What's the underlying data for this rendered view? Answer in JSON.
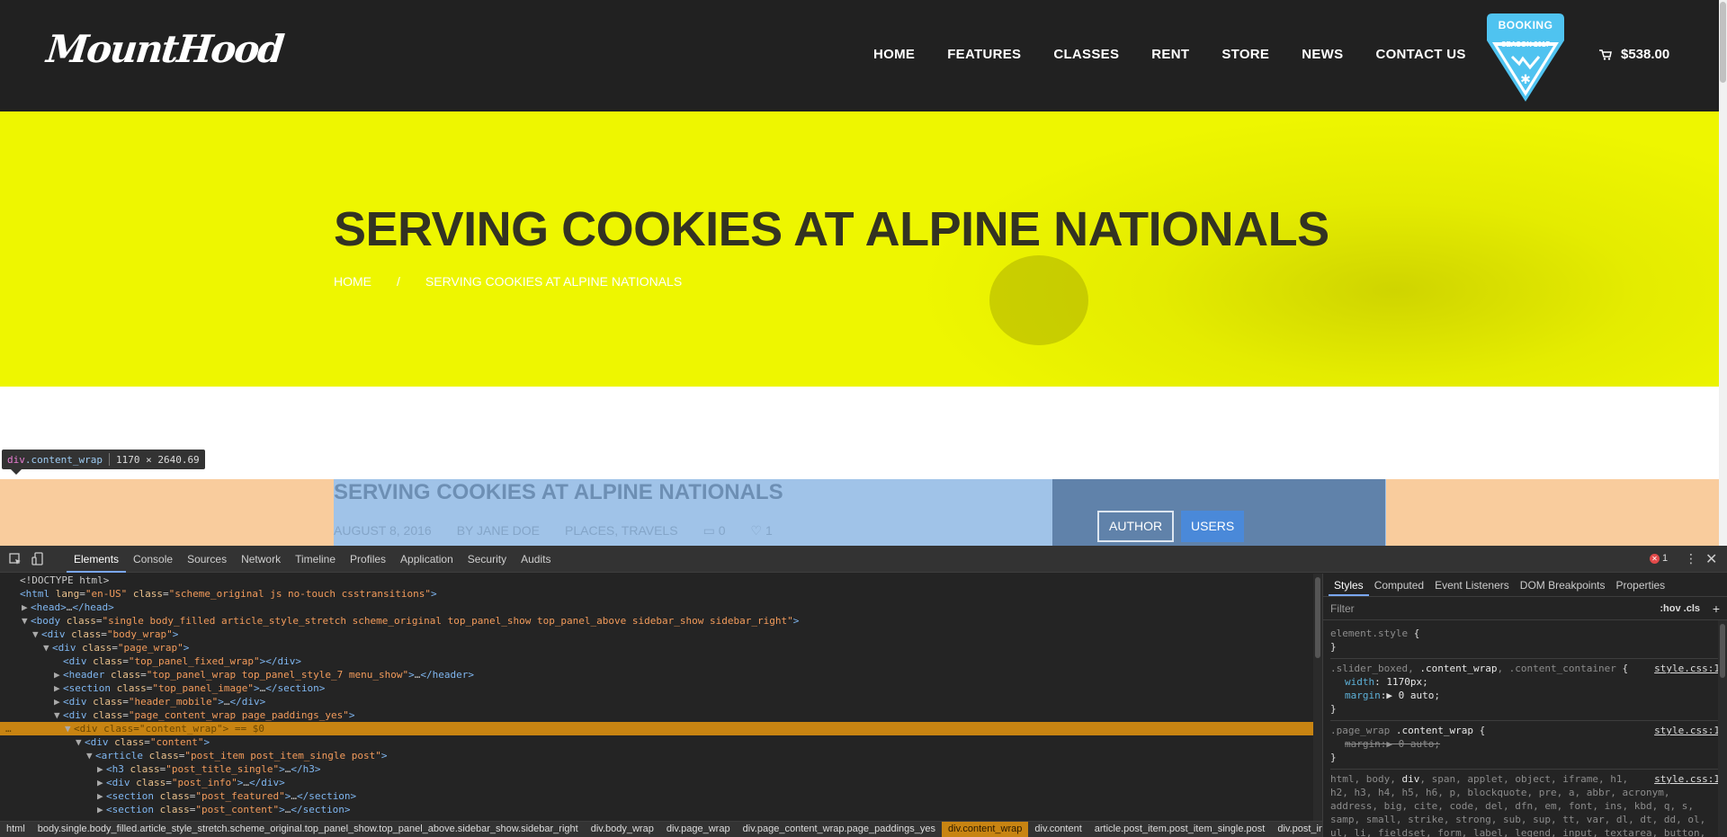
{
  "site": {
    "logo": "MountHood",
    "nav": [
      "HOME",
      "FEATURES",
      "CLASSES",
      "RENT",
      "STORE",
      "NEWS",
      "CONTACT US"
    ],
    "booking": {
      "label": "BOOKING",
      "season": "SEASON 2017"
    },
    "cart_total": "$538.00"
  },
  "hero": {
    "title": "SERVING COOKIES AT ALPINE NATIONALS",
    "breadcrumb_home": "HOME",
    "breadcrumb_sep": "/",
    "breadcrumb_current": "SERVING COOKIES AT ALPINE NATIONALS"
  },
  "inspect": {
    "tag": "div",
    "cls": ".content_wrap",
    "size": "1170 × 2640.69"
  },
  "post": {
    "title": "SERVING COOKIES AT ALPINE NATIONALS",
    "date": "AUGUST 8, 2016",
    "author": "BY JANE DOE",
    "categories": "PLACES, TRAVELS",
    "comments": "0",
    "likes": "1",
    "tab_author": "AUTHOR",
    "tab_users": "USERS"
  },
  "devtools": {
    "tabs": [
      "Elements",
      "Console",
      "Sources",
      "Network",
      "Timeline",
      "Profiles",
      "Application",
      "Security",
      "Audits"
    ],
    "error_count": "1",
    "dom": [
      {
        "indent": 0,
        "tri": "",
        "html": "&lt;!DOCTYPE html&gt;"
      },
      {
        "indent": 0,
        "tri": "",
        "html": "<span class='t-tag'>&lt;html</span> <span class='t-attr'>lang</span>=<span class='t-val'>\"en-US\"</span> <span class='t-attr'>class</span>=<span class='t-val'>\"scheme_original js no-touch csstransitions\"</span><span class='t-tag'>&gt;</span>"
      },
      {
        "indent": 1,
        "tri": "▶",
        "html": "<span class='t-tag'>&lt;head&gt;</span><span class='t-plain'>…</span><span class='t-tag'>&lt;/head&gt;</span>"
      },
      {
        "indent": 1,
        "tri": "▼",
        "html": "<span class='t-tag'>&lt;body</span> <span class='t-attr'>class</span>=<span class='t-val'>\"single body_filled article_style_stretch scheme_original top_panel_show top_panel_above sidebar_show sidebar_right\"</span><span class='t-tag'>&gt;</span>"
      },
      {
        "indent": 2,
        "tri": "▼",
        "html": "<span class='t-tag'>&lt;div</span> <span class='t-attr'>class</span>=<span class='t-val'>\"body_wrap\"</span><span class='t-tag'>&gt;</span>"
      },
      {
        "indent": 3,
        "tri": "▼",
        "html": "<span class='t-tag'>&lt;div</span> <span class='t-attr'>class</span>=<span class='t-val'>\"page_wrap\"</span><span class='t-tag'>&gt;</span>"
      },
      {
        "indent": 4,
        "tri": "",
        "html": "<span class='t-tag'>&lt;div</span> <span class='t-attr'>class</span>=<span class='t-val'>\"top_panel_fixed_wrap\"</span><span class='t-tag'>&gt;&lt;/div&gt;</span>"
      },
      {
        "indent": 4,
        "tri": "▶",
        "html": "<span class='t-tag'>&lt;header</span> <span class='t-attr'>class</span>=<span class='t-val'>\"top_panel_wrap top_panel_style_7 menu_show\"</span><span class='t-tag'>&gt;</span><span class='t-plain'>…</span><span class='t-tag'>&lt;/header&gt;</span>"
      },
      {
        "indent": 4,
        "tri": "▶",
        "html": "<span class='t-tag'>&lt;section</span> <span class='t-attr'>class</span>=<span class='t-val'>\"top_panel_image\"</span><span class='t-tag'>&gt;</span><span class='t-plain'>…</span><span class='t-tag'>&lt;/section&gt;</span>"
      },
      {
        "indent": 4,
        "tri": "▶",
        "html": "<span class='t-tag'>&lt;div</span> <span class='t-attr'>class</span>=<span class='t-val'>\"header_mobile\"</span><span class='t-tag'>&gt;</span><span class='t-plain'>…</span><span class='t-tag'>&lt;/div&gt;</span>"
      },
      {
        "indent": 4,
        "tri": "▼",
        "html": "<span class='t-tag'>&lt;div</span> <span class='t-attr'>class</span>=<span class='t-val'>\"page_content_wrap page_paddings_yes\"</span><span class='t-tag'>&gt;</span>"
      },
      {
        "indent": 5,
        "tri": "▼",
        "selected": true,
        "html": "<span class='t-tag'>&lt;div</span> <span class='t-attr'>class</span>=<span class='t-val'>\"content_wrap\"</span><span class='t-tag'>&gt;</span> <span class='t-plain'>== $0</span>"
      },
      {
        "indent": 6,
        "tri": "▼",
        "html": "<span class='t-tag'>&lt;div</span> <span class='t-attr'>class</span>=<span class='t-val'>\"content\"</span><span class='t-tag'>&gt;</span>"
      },
      {
        "indent": 7,
        "tri": "▼",
        "html": "<span class='t-tag'>&lt;article</span> <span class='t-attr'>class</span>=<span class='t-val'>\"post_item post_item_single post\"</span><span class='t-tag'>&gt;</span>"
      },
      {
        "indent": 8,
        "tri": "▶",
        "html": "<span class='t-tag'>&lt;h3</span> <span class='t-attr'>class</span>=<span class='t-val'>\"post_title_single\"</span><span class='t-tag'>&gt;</span><span class='t-plain'>…</span><span class='t-tag'>&lt;/h3&gt;</span>"
      },
      {
        "indent": 8,
        "tri": "▶",
        "html": "<span class='t-tag'>&lt;div</span> <span class='t-attr'>class</span>=<span class='t-val'>\"post_info\"</span><span class='t-tag'>&gt;</span><span class='t-plain'>…</span><span class='t-tag'>&lt;/div&gt;</span>"
      },
      {
        "indent": 8,
        "tri": "▶",
        "html": "<span class='t-tag'>&lt;section</span> <span class='t-attr'>class</span>=<span class='t-val'>\"post_featured\"</span><span class='t-tag'>&gt;</span><span class='t-plain'>…</span><span class='t-tag'>&lt;/section&gt;</span>"
      },
      {
        "indent": 8,
        "tri": "▶",
        "html": "<span class='t-tag'>&lt;section</span> <span class='t-attr'>class</span>=<span class='t-val'>\"post_content\"</span><span class='t-tag'>&gt;</span><span class='t-plain'>…</span><span class='t-tag'>&lt;/section&gt;</span>"
      }
    ],
    "crumbs": [
      "html",
      "body.single.body_filled.article_style_stretch.scheme_original.top_panel_show.top_panel_above.sidebar_show.sidebar_right",
      "div.body_wrap",
      "div.page_wrap",
      "div.page_content_wrap.page_paddings_yes",
      "div.content_wrap",
      "div.content",
      "article.post_item.post_item_single.post",
      "div.post_info"
    ],
    "active_crumb": 5,
    "styles_tabs": [
      "Styles",
      "Computed",
      "Event Listeners",
      "DOM Breakpoints",
      "Properties"
    ],
    "filter_placeholder": "Filter",
    "filter_opts": ":hov  .cls",
    "filter_plus": "+"
  }
}
